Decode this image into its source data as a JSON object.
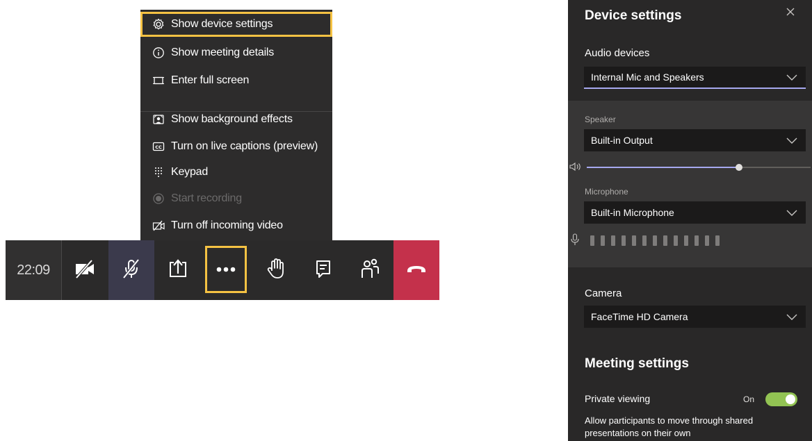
{
  "menu": {
    "items": [
      {
        "label": "Show device settings",
        "icon": "gear-icon"
      },
      {
        "label": "Show meeting details",
        "icon": "info-icon"
      },
      {
        "label": "Enter full screen",
        "icon": "fullscreen-icon"
      },
      {
        "label": "Show background effects",
        "icon": "background-effects-icon"
      },
      {
        "label": "Turn on live captions (preview)",
        "icon": "captions-icon"
      },
      {
        "label": "Keypad",
        "icon": "keypad-icon"
      },
      {
        "label": "Start recording",
        "icon": "record-icon",
        "disabled": true
      },
      {
        "label": "Turn off incoming video",
        "icon": "video-off-icon"
      }
    ]
  },
  "toolbar": {
    "time": "22:09",
    "buttons": [
      "camera-off-icon",
      "mic-off-icon",
      "share-screen-icon",
      "more-options-icon",
      "raise-hand-icon",
      "chat-icon",
      "participants-icon",
      "hang-up-icon"
    ],
    "colors": {
      "hangup": "#c4314b",
      "highlight": "#f5c243"
    }
  },
  "panel": {
    "title": "Device settings",
    "audio_devices_label": "Audio devices",
    "audio_device_value": "Internal Mic and Speakers",
    "speaker_label": "Speaker",
    "speaker_value": "Built-in Output",
    "speaker_volume": 0.68,
    "microphone_label": "Microphone",
    "microphone_value": "Built-in Microphone",
    "mic_level_segments": 13,
    "camera_label": "Camera",
    "camera_value": "FaceTime HD Camera",
    "meeting_settings_heading": "Meeting settings",
    "private_viewing_label": "Private viewing",
    "private_viewing_state": "On",
    "private_viewing_desc": "Allow participants to move through shared presentations on their own"
  }
}
